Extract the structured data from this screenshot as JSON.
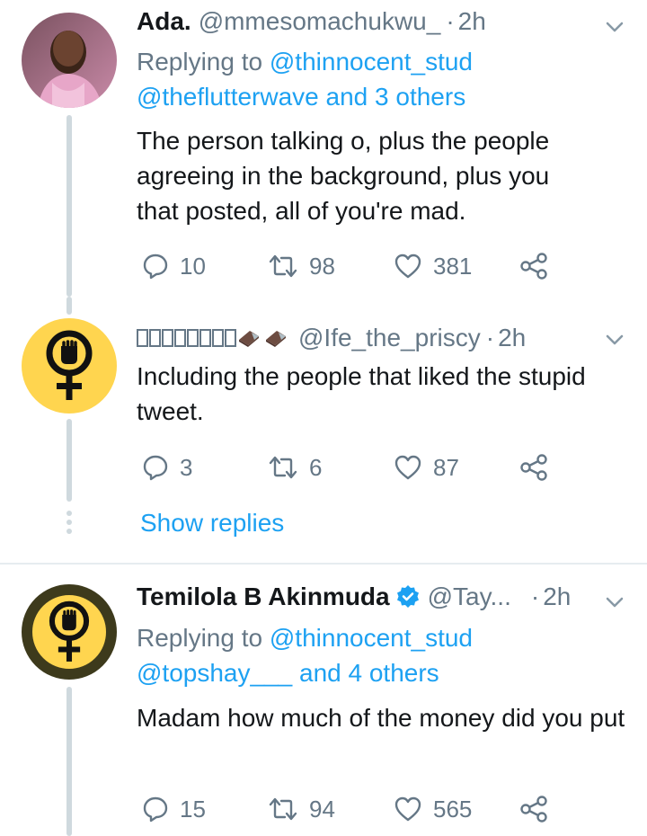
{
  "tweets": [
    {
      "name": "Ada.",
      "handle": "@mmesomachukwu_",
      "time": "2h",
      "reply_prefix": "Replying to ",
      "reply_user": "@thinnocent_stud",
      "reply_line2_user": "@theflutterwave",
      "reply_line2_rest": " and 3 others",
      "text": "The person talking o, plus the people agreeing in the background, plus you that posted, all of you're mad.",
      "replies": "10",
      "retweets": "98",
      "likes": "381"
    },
    {
      "name_glyphs": 8,
      "handle": "@Ife_the_priscy",
      "time": "2h",
      "text": "Including the people that liked the stupid tweet.",
      "replies": "3",
      "retweets": "6",
      "likes": "87",
      "show_replies": "Show replies"
    },
    {
      "name": "Temilola B Akinmuda",
      "handle": "@Tay...",
      "time": "2h",
      "verified": true,
      "reply_prefix": "Replying to ",
      "reply_user": "@thinnocent_stud",
      "reply_line2_user": "@topshay___",
      "reply_line2_rest": " and 4 others",
      "text": "Madam how much of the money did you put",
      "replies": "15",
      "retweets": "94",
      "likes": "565"
    }
  ],
  "colors": {
    "link": "#1da1f2",
    "muted": "#657786",
    "text": "#14171a",
    "avatar_yellow": "#ffd54f"
  },
  "icons": [
    "reply-icon",
    "retweet-icon",
    "like-icon",
    "share-icon",
    "chevron-down-icon",
    "verified-badge-icon",
    "female-fist-icon",
    "chocolate-emoji-icon"
  ]
}
